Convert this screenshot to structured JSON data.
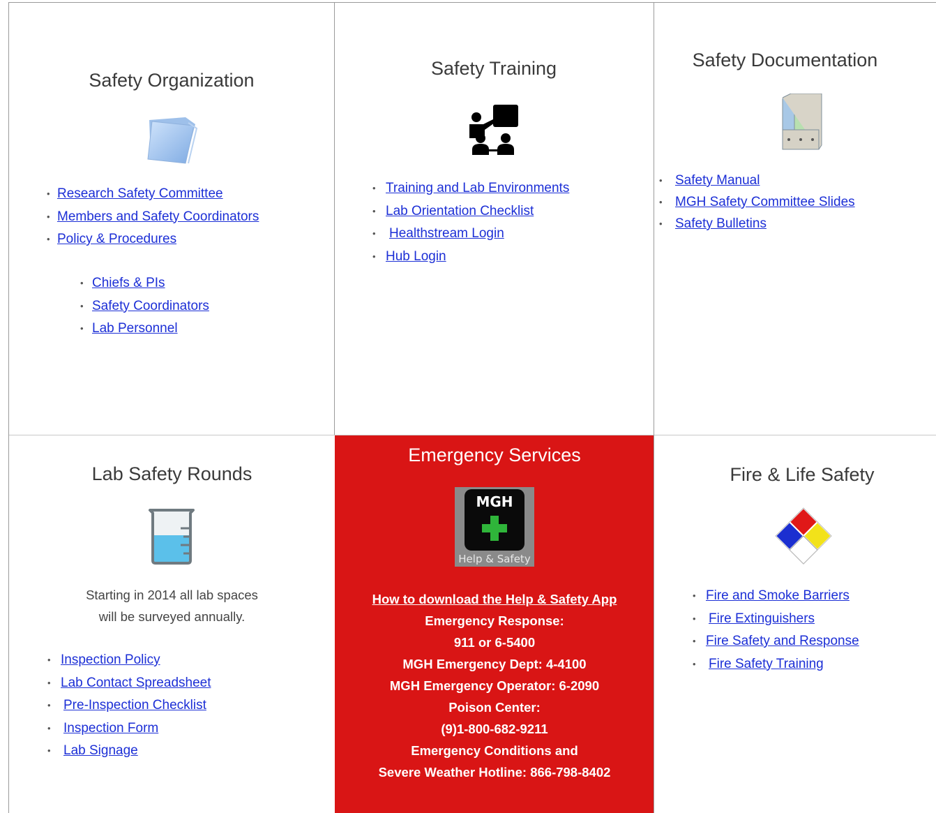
{
  "organization": {
    "title": "Safety Organization",
    "links": [
      "Research Safety Committee",
      "Members and Safety Coordinators",
      "Policy & Procedures"
    ],
    "sublinks": [
      "Chiefs & PIs",
      "Safety Coordinators",
      "Lab Personnel"
    ]
  },
  "training": {
    "title": "Safety Training",
    "links": [
      "Training and Lab Environments",
      "Lab Orientation Checklist",
      "Healthstream Login",
      "Hub Login"
    ]
  },
  "documentation": {
    "title": "Safety Documentation",
    "links": [
      "Safety Manual",
      "MGH Safety Committee Slides",
      "Safety Bulletins"
    ]
  },
  "rounds": {
    "title": "Lab Safety Rounds",
    "note_line1": "Starting in 2014 all lab spaces",
    "note_line2": "will be surveyed annually.",
    "links": [
      "Inspection Policy",
      "Lab Contact Spreadsheet",
      "Pre-Inspection Checklist",
      "Inspection Form",
      "Lab Signage"
    ]
  },
  "emergency": {
    "title": "Emergency Services",
    "app_logo_top": "MGH",
    "app_logo_bottom": "Help & Safety",
    "download_link": "How to download the Help & Safety App",
    "lines": [
      "Emergency Response:",
      "911 or 6-5400",
      "MGH Emergency Dept: 4-4100",
      "MGH Emergency Operator: 6-2090",
      "Poison Center:",
      "(9)1-800-682-9211",
      "Emergency Conditions and",
      "Severe Weather Hotline: 866-798-8402"
    ],
    "bg_color": "#d91515"
  },
  "fire": {
    "title": "Fire & Life Safety",
    "links": [
      "Fire and Smoke Barriers",
      "Fire Extinguishers",
      "Fire Safety and Response",
      "Fire Safety Training"
    ]
  },
  "colors": {
    "link": "#1c2fd6",
    "title": "#3a3a3a"
  },
  "bullet": "•"
}
